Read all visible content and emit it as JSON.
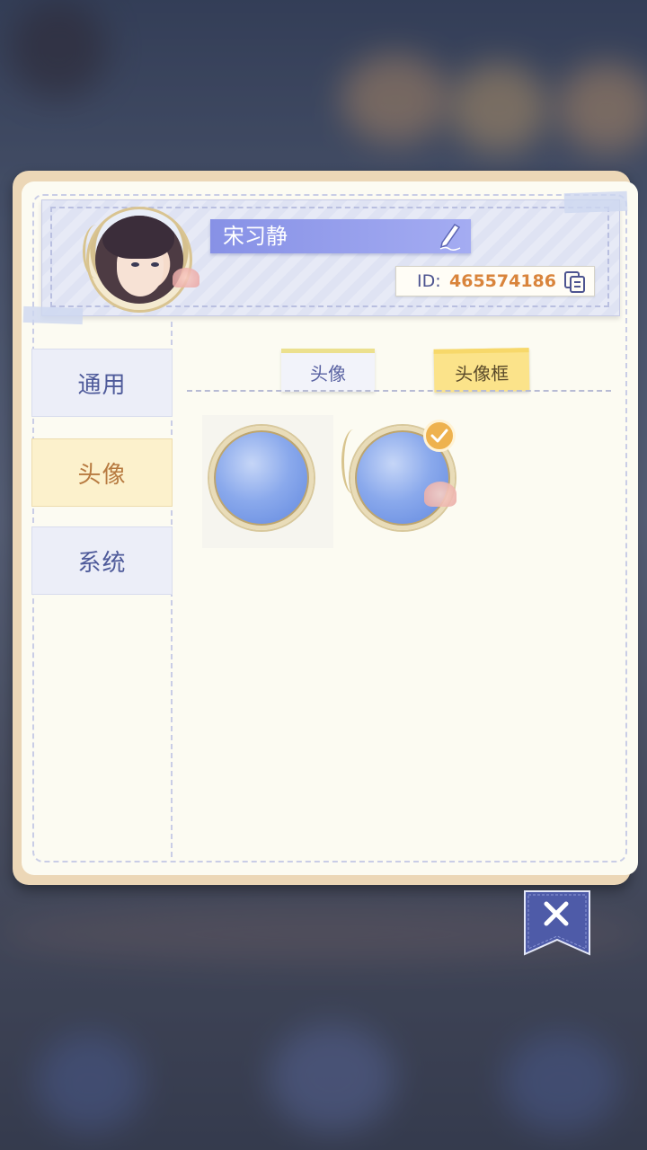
{
  "profile": {
    "name": "宋习静",
    "id_label": "ID:",
    "id_value": "465574186"
  },
  "nav": {
    "items": [
      {
        "label": "通用",
        "active": false
      },
      {
        "label": "头像",
        "active": true
      },
      {
        "label": "系统",
        "active": false
      }
    ]
  },
  "tabs": [
    {
      "label": "头像",
      "active": false
    },
    {
      "label": "头像框",
      "active": true
    }
  ],
  "frames": [
    {
      "name": "plain-gold-frame",
      "selected": false
    },
    {
      "name": "jellyfish-frame",
      "selected": true
    }
  ],
  "colors": {
    "accent_blue": "#8791e6",
    "accent_gold": "#eeb24f",
    "id_orange": "#d9843b",
    "active_nav": "#fcf1cc"
  }
}
